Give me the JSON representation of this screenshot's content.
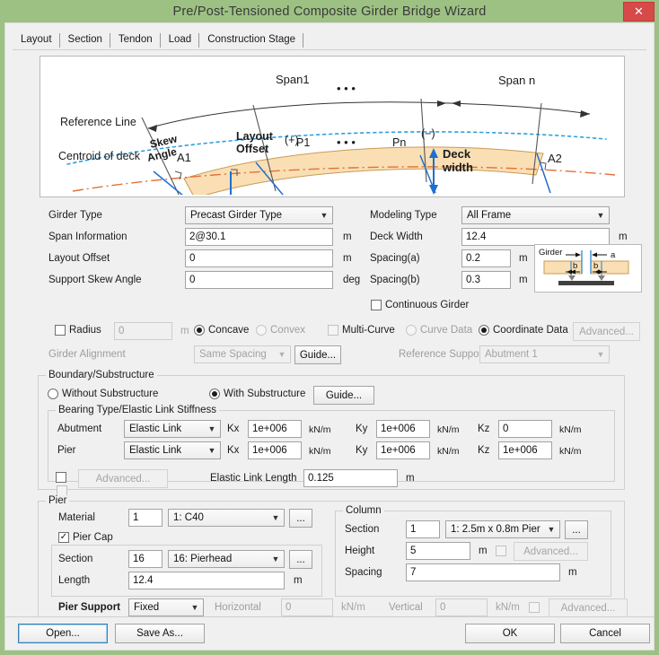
{
  "window": {
    "title": "Pre/Post-Tensioned Composite Girder Bridge Wizard",
    "close_label": "✕",
    "titlebar_color": "#9dc183",
    "close_color": "#d64a4a"
  },
  "tabs": [
    {
      "label": "Layout",
      "active": true
    },
    {
      "label": "Section",
      "active": false
    },
    {
      "label": "Tendon",
      "active": false
    },
    {
      "label": "Load",
      "active": false
    },
    {
      "label": "Construction Stage",
      "active": false
    }
  ],
  "diagram": {
    "span1": "Span1",
    "span_n": "Span n",
    "reference_line": "Reference Line",
    "centroid_of_deck": "Centroid of deck",
    "skew_angle": "Skew",
    "skew_angle2": "Angle",
    "layout_offset": "Layout",
    "layout_offset2": "Offset",
    "deck_width": "Deck",
    "deck_width2": "width",
    "plus_sign": "(+)",
    "minus_sign": "(−)",
    "a1": "A1",
    "a2": "A2",
    "p1": "P1",
    "pn": "Pn",
    "dots": "• • •"
  },
  "left_form": {
    "girder_type_label": "Girder Type",
    "girder_type_value": "Precast Girder Type",
    "span_information_label": "Span Information",
    "span_information_value": "2@30.1",
    "span_information_unit": "m",
    "layout_offset_label": "Layout Offset",
    "layout_offset_value": "0",
    "layout_offset_unit": "m",
    "support_skew_angle_label": "Support Skew Angle",
    "support_skew_angle_value": "0",
    "support_skew_angle_unit": "deg"
  },
  "right_form": {
    "modeling_type_label": "Modeling Type",
    "modeling_type_value": "All Frame",
    "deck_width_label": "Deck Width",
    "deck_width_value": "12.4",
    "deck_width_unit": "m",
    "spacing_a_label": "Spacing(a)",
    "spacing_a_value": "0.2",
    "spacing_a_unit": "m",
    "spacing_b_label": "Spacing(b)",
    "spacing_b_value": "0.3",
    "spacing_b_unit": "m",
    "continuous_girder_label": "Continuous Girder",
    "continuous_girder_checked": false,
    "girder_pic": {
      "girder": "Girder",
      "a": "a",
      "b1": "b",
      "b2": "b"
    }
  },
  "curve_row": {
    "radius_label": "Radius",
    "radius_checked": false,
    "radius_value": "0",
    "radius_unit": "m",
    "concave_label": "Concave",
    "concave_selected": true,
    "convex_label": "Convex",
    "convex_selected": false,
    "multi_curve_label": "Multi-Curve",
    "multi_curve_checked": false,
    "curve_data_label": "Curve Data",
    "curve_data_selected": false,
    "coordinate_data_label": "Coordinate Data",
    "coordinate_data_selected": true,
    "advanced_label": "Advanced..."
  },
  "alignment_row": {
    "girder_alignment_label": "Girder Alignment",
    "girder_alignment_value": "Same Spacing",
    "guide_label": "Guide...",
    "reference_support_label": "Reference Support",
    "reference_support_value": "Abutment 1"
  },
  "boundary": {
    "group_title": "Boundary/Substructure",
    "without_substructure_label": "Without Substructure",
    "without_substructure_selected": false,
    "with_substructure_label": "With Substructure",
    "with_substructure_selected": true,
    "guide_label": "Guide...",
    "bearing_group_title": "Bearing Type/Elastic Link Stiffness",
    "rows": [
      {
        "name": "Abutment",
        "type": "Elastic Link",
        "kx_label": "Kx",
        "kx_value": "1e+006",
        "kx_unit": "kN/m",
        "ky_label": "Ky",
        "ky_value": "1e+006",
        "ky_unit": "kN/m",
        "kz_label": "Kz",
        "kz_value": "0",
        "kz_unit": "kN/m"
      },
      {
        "name": "Pier",
        "type": "Elastic Link",
        "kx_label": "Kx",
        "kx_value": "1e+006",
        "kx_unit": "kN/m",
        "ky_label": "Ky",
        "ky_value": "1e+006",
        "ky_unit": "kN/m",
        "kz_label": "Kz",
        "kz_value": "1e+006",
        "kz_unit": "kN/m"
      }
    ],
    "advanced_label": "Advanced...",
    "advanced_checked": false,
    "elastic_link_length_label": "Elastic Link Length",
    "elastic_link_length_value": "0.125",
    "elastic_link_length_unit": "m"
  },
  "pier": {
    "group_title": "Pier",
    "material_label": "Material",
    "material_id": "1",
    "material_value": "1: C40",
    "ellipsis_label": "...",
    "pier_cap_label": "Pier Cap",
    "pier_cap_checked": true,
    "section_label": "Section",
    "section_id": "16",
    "section_value": "16: Pierhead",
    "length_label": "Length",
    "length_value": "12.4",
    "length_unit": "m",
    "pier_support_label": "Pier Support",
    "pier_support_value": "Fixed",
    "horizontal_label": "Horizontal",
    "horizontal_value": "0",
    "horizontal_unit": "kN/m",
    "vertical_label": "Vertical",
    "vertical_value": "0",
    "vertical_unit": "kN/m",
    "advanced_label": "Advanced...",
    "advanced_checked": false
  },
  "column": {
    "group_title": "Column",
    "section_label": "Section",
    "section_id": "1",
    "section_value": "1: 2.5m x 0.8m Pier",
    "ellipsis_label": "...",
    "height_label": "Height",
    "height_value": "5",
    "height_unit": "m",
    "advanced_label": "Advanced...",
    "advanced_checked": false,
    "spacing_label": "Spacing",
    "spacing_value": "7",
    "spacing_unit": "m"
  },
  "footer": {
    "open_label": "Open...",
    "save_as_label": "Save As...",
    "ok_label": "OK",
    "cancel_label": "Cancel"
  }
}
